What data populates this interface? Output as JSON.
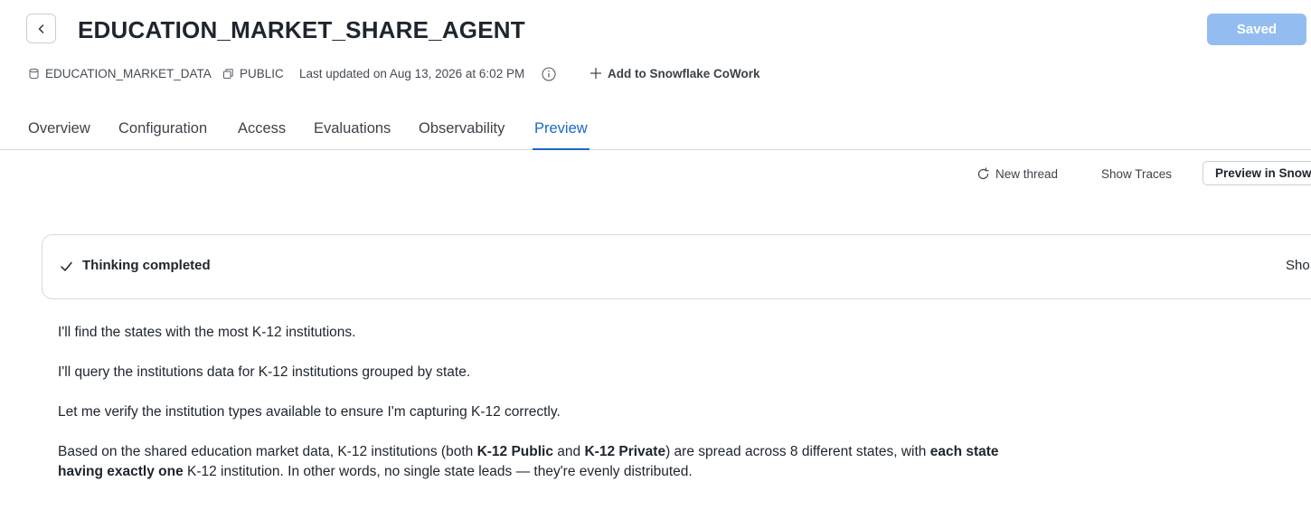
{
  "header": {
    "title": "EDUCATION_MARKET_SHARE_AGENT",
    "saved_label": "Saved",
    "back_icon": "chevron-left-icon"
  },
  "meta": {
    "database": "EDUCATION_MARKET_DATA",
    "schema": "PUBLIC",
    "last_updated": "Last updated on Aug 13, 2026 at 6:02 PM",
    "add_link": "Add to Snowflake CoWork"
  },
  "tabs": [
    {
      "label": "Overview",
      "active": false
    },
    {
      "label": "Configuration",
      "active": false
    },
    {
      "label": "Access",
      "active": false
    },
    {
      "label": "Evaluations",
      "active": false
    },
    {
      "label": "Observability",
      "active": false
    },
    {
      "label": "Preview",
      "active": true
    }
  ],
  "toolbar": {
    "new_thread": "New thread",
    "show_traces": "Show Traces",
    "preview_in": "Preview in Snowf"
  },
  "thinking": {
    "label": "Thinking completed",
    "toggle": "Sho"
  },
  "response": {
    "p1": "I'll find the states with the most K-12 institutions.",
    "p2": "I'll query the institutions data for K-12 institutions grouped by state.",
    "p3": "Let me verify the institution types available to ensure I'm capturing K-12 correctly.",
    "p4_a": "Based on the shared education market data, K-12 institutions (both ",
    "p4_b": "K-12 Public",
    "p4_c": " and ",
    "p4_d": "K-12 Private",
    "p4_e": ") are spread across 8 different states, with ",
    "p4_f": "each state having exactly one",
    "p4_g": " K-12 institution. In other words, no single state leads — they're evenly distributed."
  },
  "colors": {
    "accent": "#1a6ac2",
    "saved_button": "#93bdf0",
    "border": "#d5d9de"
  }
}
